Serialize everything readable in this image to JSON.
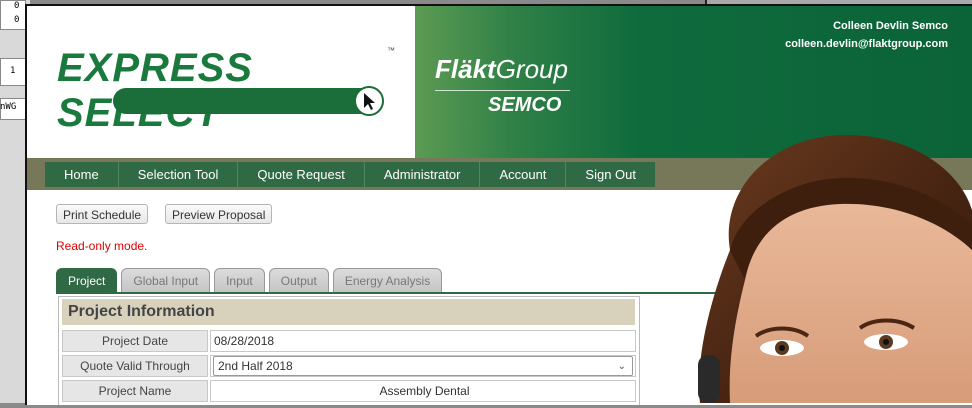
{
  "background": {
    "cells": [
      "0",
      "0",
      "1",
      "nWG"
    ]
  },
  "header": {
    "logo_text": "EXPRESS SELECT",
    "logo_tm": "™",
    "brand_main": "Fläkt",
    "brand_sub": "Group",
    "brand_semco": "SEMCO",
    "user_name": "Colleen Devlin Semco",
    "user_email": "colleen.devlin@flaktgroup.com"
  },
  "nav": {
    "items": [
      "Home",
      "Selection Tool",
      "Quote Request",
      "Administrator",
      "Account",
      "Sign Out"
    ]
  },
  "actions": {
    "print_schedule": "Print Schedule",
    "preview_proposal": "Preview Proposal"
  },
  "status": {
    "readonly": "Read-only mode."
  },
  "tabs": [
    "Project",
    "Global Input",
    "Input",
    "Output",
    "Energy Analysis"
  ],
  "project_info": {
    "title": "Project Information",
    "rows": [
      {
        "label": "Project Date",
        "value": "08/28/2018"
      },
      {
        "label": "Quote Valid Through",
        "value": "2nd Half 2018"
      },
      {
        "label": "Project Name",
        "value": "Assembly Dental"
      }
    ]
  },
  "colors": {
    "brand_green": "#2f6a45",
    "header_green": "#0b6338",
    "readonly_red": "#e00000",
    "nav_band": "#77775a"
  }
}
